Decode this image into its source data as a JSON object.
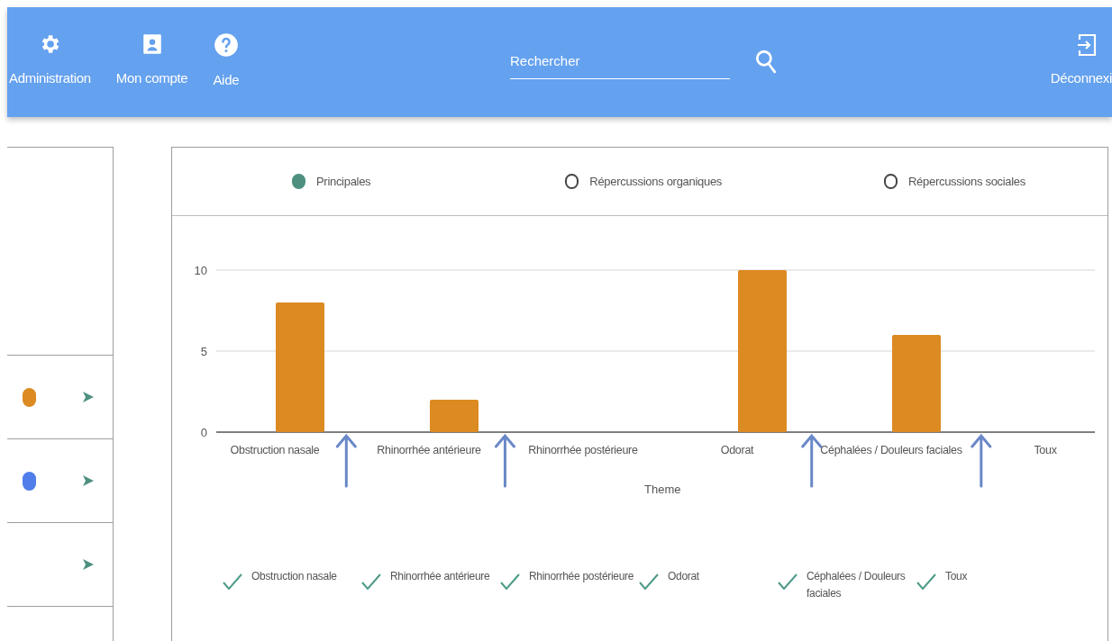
{
  "toolbar": {
    "items": [
      {
        "kind": "gear",
        "label": "Administration"
      },
      {
        "kind": "account",
        "label": "Mon compte"
      },
      {
        "kind": "help",
        "label": "Aide"
      }
    ],
    "search": {
      "placeholder": "Rechercher"
    },
    "logout": {
      "label": "Déconnexi"
    }
  },
  "side_list": {
    "rows": [
      {
        "color": "#dc8a22"
      },
      {
        "color": "#4f7eea"
      },
      {}
    ]
  },
  "chart_card": {
    "tabs": [
      {
        "label": "Principales",
        "selected": true
      },
      {
        "label": "Répercussions organiques",
        "selected": false
      },
      {
        "label": "Répercussions sociales",
        "selected": false
      }
    ],
    "chart_data": {
      "type": "bar",
      "xlabel": "Theme",
      "categories": [
        "Obstruction nasale",
        "Rhinorrhée antérieure",
        "Rhinorrhée postérieure",
        "Odorat",
        "Céphalées / Douleurs faciales",
        "Toux"
      ],
      "series": [
        {
          "color": "#dc8a22",
          "values": [
            8,
            2,
            0,
            10,
            6,
            0
          ]
        }
      ],
      "ylim": [
        0,
        10
      ],
      "yticks": [
        0,
        5,
        10
      ]
    },
    "arrows": [
      {
        "kind": "up"
      },
      {
        "kind": "up"
      },
      {
        "kind": "up"
      },
      {
        "kind": "up"
      }
    ],
    "filters": [
      {
        "label": "Obstruction nasale",
        "checked": true
      },
      {
        "label": "Rhinorrhée antérieure",
        "checked": true
      },
      {
        "label": "Rhinorrhée postérieure",
        "checked": true
      },
      {
        "label": "Odorat",
        "checked": true
      },
      {
        "label": "Céphalées / Douleurs faciales",
        "checked": true
      },
      {
        "label": "Toux",
        "checked": true
      }
    ]
  }
}
